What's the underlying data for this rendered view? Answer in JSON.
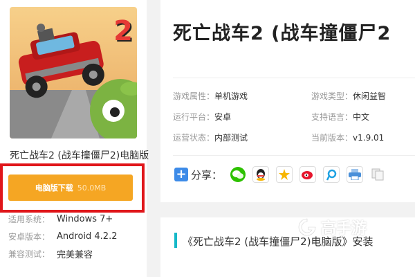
{
  "app": {
    "name": "死亡战车2 (战车撞僵尸2)电脑版",
    "icon_badge": "2"
  },
  "download": {
    "label": "电脑版下载",
    "size": "50.0MB"
  },
  "specs": [
    {
      "label": "适用系统：",
      "value": "Windows 7+"
    },
    {
      "label": "安卓版本：",
      "value": "Android 4.2.2"
    },
    {
      "label": "兼容测试：",
      "value": "完美兼容"
    }
  ],
  "main": {
    "title": "死亡战车2 (战车撞僵尸2"
  },
  "info": [
    {
      "left_label": "游戏属性：",
      "left_value": "单机游戏",
      "right_label": "游戏类型：",
      "right_value": "休闲益智"
    },
    {
      "left_label": "运行平台：",
      "left_value": "安卓",
      "right_label": "支持语言：",
      "right_value": "中文"
    },
    {
      "left_label": "运营状态：",
      "left_value": "内部测试",
      "right_label": "当前版本：",
      "right_value": "v1.9.01"
    }
  ],
  "share": {
    "label": "分享：",
    "icons": [
      {
        "name": "wechat-icon",
        "color": "#2dc100"
      },
      {
        "name": "qq-icon",
        "color": "#2b2b2b"
      },
      {
        "name": "qzone-icon",
        "color": "#f7b500"
      },
      {
        "name": "weibo-icon",
        "color": "#e6162d"
      },
      {
        "name": "tencent-weibo-icon",
        "color": "#1da1e2"
      },
      {
        "name": "print-icon",
        "color": "#4a90d9"
      },
      {
        "name": "copy-icon",
        "color": "#c8c8c8"
      }
    ]
  },
  "section": {
    "title": "《死亡战车2 (战车撞僵尸2)电脑版》安装"
  },
  "watermark": {
    "text": "高手游"
  },
  "colors": {
    "download_button": "#f5a623",
    "highlight_frame": "#e0161a",
    "section_accent": "#16b8c8"
  }
}
